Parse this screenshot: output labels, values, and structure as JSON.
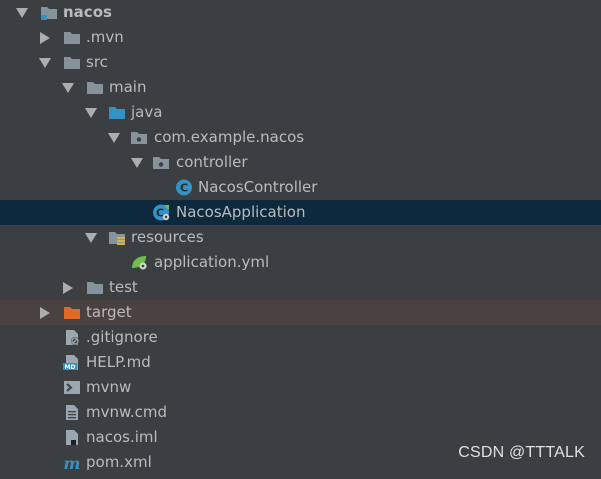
{
  "tree": {
    "nacos": "nacos",
    "mvn": ".mvn",
    "src": "src",
    "main": "main",
    "java": "java",
    "package": "com.example.nacos",
    "controller": "controller",
    "nacos_controller": "NacosController",
    "nacos_application": "NacosApplication",
    "resources": "resources",
    "application_yml": "application.yml",
    "test": "test",
    "target": "target",
    "gitignore": ".gitignore",
    "help_md": "HELP.md",
    "mvnw": "mvnw",
    "mvnw_cmd": "mvnw.cmd",
    "nacos_iml": "nacos.iml",
    "pom_xml": "pom.xml"
  },
  "watermark": "CSDN @TTTALK",
  "icons": {
    "folder": "folder-icon",
    "source_folder": "source-folder-icon",
    "package": "package-icon",
    "resources_folder": "resources-folder-icon",
    "excluded_folder": "excluded-folder-icon",
    "class": "class-icon",
    "spring_boot_app": "spring-boot-application-icon",
    "yaml": "yaml-config-icon",
    "ignore_file": "gitignore-file-icon",
    "markdown": "markdown-file-icon",
    "shell": "shell-script-icon",
    "text": "text-file-icon",
    "module": "module-file-icon",
    "maven": "maven-pom-icon"
  },
  "colors": {
    "background": "#3c3f41",
    "selection": "#0d293e",
    "excluded_row": "#4a4240",
    "text": "#bbbbbb",
    "folder": "#87939a",
    "source_folder": "#3592c4",
    "excluded_folder": "#e06a2c",
    "class_icon": "#3592c4"
  }
}
